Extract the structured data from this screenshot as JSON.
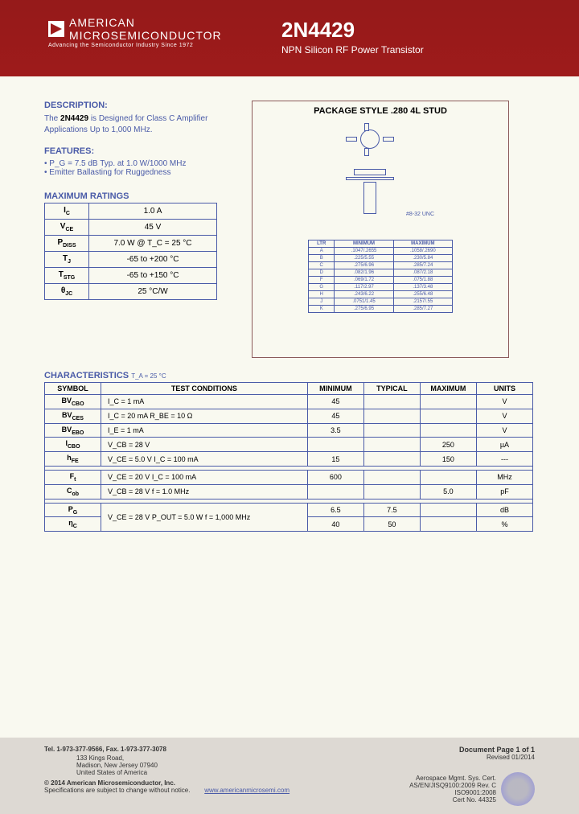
{
  "header": {
    "company1": "AMERICAN",
    "company2": "MICROSEMICONDUCTOR",
    "tagline": "Advancing the Semiconductor Industry Since 1972",
    "part_number": "2N4429",
    "subtitle": "NPN Silicon RF Power Transistor"
  },
  "description": {
    "heading": "DESCRIPTION:",
    "pre": "The ",
    "bold": "2N4429",
    "post": " is Designed for Class C Amplifier Applications Up to 1,000 MHz."
  },
  "features": {
    "heading": "FEATURES:",
    "items": [
      "P_G = 7.5 dB Typ. at 1.0 W/1000 MHz",
      "Emitter Ballasting for Ruggedness"
    ]
  },
  "ratings": {
    "heading": "MAXIMUM RATINGS",
    "rows": [
      {
        "sym": "I_C",
        "val": "1.0 A"
      },
      {
        "sym": "V_CE",
        "val": "45 V"
      },
      {
        "sym": "P_DISS",
        "val": "7.0 W @ T_C = 25 °C"
      },
      {
        "sym": "T_J",
        "val": "-65 to +200 °C"
      },
      {
        "sym": "T_STG",
        "val": "-65 to +150 °C"
      },
      {
        "sym": "θ_JC",
        "val": "25 °C/W"
      }
    ]
  },
  "package": {
    "title": "PACKAGE  STYLE  .280 4L STUD",
    "thread": "#8-32 UNC",
    "dim_headers": [
      "LTR",
      "MINIMUM",
      "MAXIMUM"
    ],
    "dims": [
      {
        "l": "A",
        "min": ".1047/.2655",
        "max": ".1058/.2690"
      },
      {
        "l": "B",
        "min": ".225/5.55",
        "max": ".230/5.84"
      },
      {
        "l": "C",
        "min": ".275/6.96",
        "max": ".285/7.24"
      },
      {
        "l": "D",
        "min": ".082/1.96",
        "max": ".087/2.18"
      },
      {
        "l": "F",
        "min": ".069/1.72",
        "max": ".075/1.88"
      },
      {
        "l": "G",
        "min": ".117/2.97",
        "max": ".137/3.48"
      },
      {
        "l": "H",
        "min": ".243/6.22",
        "max": ".255/6.48"
      },
      {
        "l": "J",
        "min": ".0751/1.45",
        "max": ".2157/.55"
      },
      {
        "l": "K",
        "min": ".275/6.95",
        "max": ".285/7.27"
      }
    ]
  },
  "characteristics": {
    "heading": "CHARACTERISTICS",
    "cond_note": "T_A = 25 °C",
    "headers": [
      "SYMBOL",
      "TEST CONDITIONS",
      "MINIMUM",
      "TYPICAL",
      "MAXIMUM",
      "UNITS"
    ],
    "rows": [
      {
        "sym": "BV_CBO",
        "cond": "I_C = 1 mA",
        "min": "45",
        "typ": "",
        "max": "",
        "unit": "V"
      },
      {
        "sym": "BV_CES",
        "cond": "I_C = 20 mA        R_BE = 10 Ω",
        "min": "45",
        "typ": "",
        "max": "",
        "unit": "V"
      },
      {
        "sym": "BV_EBO",
        "cond": "I_E = 1 mA",
        "min": "3.5",
        "typ": "",
        "max": "",
        "unit": "V"
      },
      {
        "sym": "I_CBO",
        "cond": "V_CB = 28 V",
        "min": "",
        "typ": "",
        "max": "250",
        "unit": "µA"
      },
      {
        "sym": "h_FE",
        "cond": "V_CE = 5.0 V        I_C = 100 mA",
        "min": "15",
        "typ": "",
        "max": "150",
        "unit": "---"
      }
    ],
    "rows2": [
      {
        "sym": "F_t",
        "cond": "V_CE = 20 V        I_C = 100 mA",
        "min": "600",
        "typ": "",
        "max": "",
        "unit": "MHz"
      },
      {
        "sym": "C_ob",
        "cond": "V_CB = 28 V                          f = 1.0 MHz",
        "min": "",
        "typ": "",
        "max": "5.0",
        "unit": "pF"
      }
    ],
    "rows3": [
      {
        "sym": "P_G",
        "cond_top": "V_CE = 28 V        P_OUT = 5.0 W            f = 1,000 MHz",
        "min": "6.5",
        "typ": "7.5",
        "max": "",
        "unit": "dB"
      },
      {
        "sym": "η_C",
        "cond_top": "",
        "min": "40",
        "typ": "50",
        "max": "",
        "unit": "%"
      }
    ]
  },
  "footer": {
    "tel": "Tel. 1-973-377-9566,  Fax. 1-973-377-3078",
    "addr1": "133 Kings Road,",
    "addr2": "Madison, New Jersey  07940",
    "addr3": "United States of America",
    "copyright": "© 2014 American Microsemiconductor, Inc.",
    "disclaimer": "Specifications are subject to change without notice.",
    "url": "www.americanmicrosemi.com",
    "doc_page": "Document Page 1 of 1",
    "revised": "Revised 01/2014",
    "cert1": "Aerospace Mgmt. Sys. Cert.",
    "cert2": "AS/EN/JISQ9100:2009 Rev. C",
    "cert3": "ISO9001:2008",
    "cert4": "Cert No. 44325"
  }
}
